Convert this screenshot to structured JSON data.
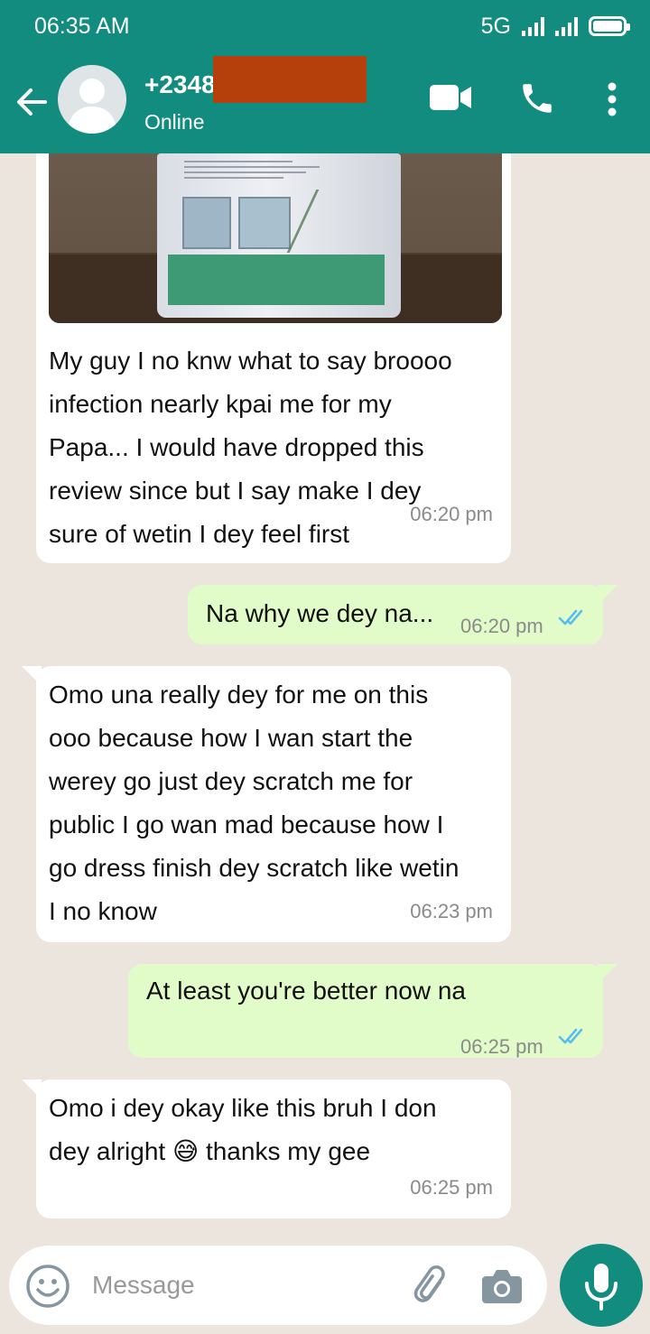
{
  "status_bar": {
    "time": "06:35 AM",
    "network": "5G"
  },
  "header": {
    "contact_name": "+2348",
    "contact_status": "Online",
    "icons": [
      "back-arrow-icon",
      "avatar",
      "video-call-icon",
      "phone-call-icon",
      "more-vert-icon"
    ]
  },
  "messages": [
    {
      "direction": "incoming",
      "has_image": true,
      "text": "My guy I no knw what to say broooo\ninfection nearly kpai me for my\nPapa... I would have dropped this\nreview since but I say make I dey\nsure of wetin I dey feel first",
      "time": "06:20 pm"
    },
    {
      "direction": "outgoing",
      "text": "Na why we dey na...",
      "time": "06:20 pm",
      "read": true
    },
    {
      "direction": "incoming",
      "text": "Omo una really dey for me on this\nooo because how I wan start the\nwerey go just dey scratch me for\npublic I go wan mad because how I\ngo dress finish dey scratch like wetin\nI no know",
      "time": "06:23 pm"
    },
    {
      "direction": "outgoing",
      "text": "At least you're better now na",
      "time": "06:25 pm",
      "read": true
    },
    {
      "direction": "incoming",
      "text_before_emoji": "Omo i dey okay like this bruh I don\ndey alright ",
      "emoji": "😅",
      "text_after_emoji": " thanks my gee",
      "time": "06:25 pm"
    }
  ],
  "composer": {
    "placeholder": "Message"
  },
  "colors": {
    "header": "#128c7e",
    "outgoing_bubble": "#e2fcc9",
    "incoming_bubble": "#ffffff",
    "background": "#ece5dd",
    "read_ticks": "#53bdeb"
  }
}
